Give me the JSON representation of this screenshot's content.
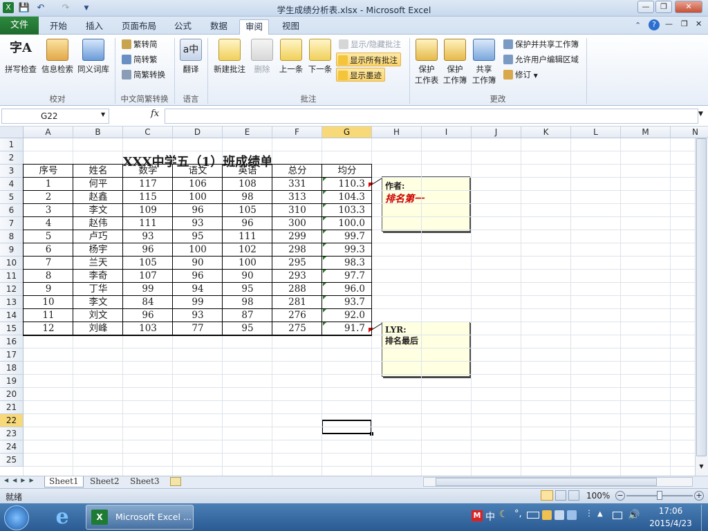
{
  "titlebar": {
    "title": "学生成绩分析表.xlsx - Microsoft Excel"
  },
  "tabs": {
    "file": "文件",
    "items": [
      "开始",
      "插入",
      "页面布局",
      "公式",
      "数据",
      "审阅",
      "视图"
    ],
    "active": "审阅"
  },
  "ribbon": {
    "proofing": {
      "spell": "拼写检查",
      "research": "信息检索",
      "thesaurus": "同义词库",
      "label": "校对"
    },
    "chinese": {
      "t2s": "繁转简",
      "s2t": "简转繁",
      "convert": "简繁转换",
      "label": "中文简繁转换"
    },
    "language": {
      "translate": "翻译",
      "label": "语言"
    },
    "comments": {
      "new": "新建批注",
      "delete": "删除",
      "prev": "上一条",
      "next": "下一条",
      "showhide": "显示/隐藏批注",
      "showall": "显示所有批注",
      "showink": "显示墨迹",
      "label": "批注"
    },
    "changes": {
      "protect_sheet_1": "保护",
      "protect_sheet_2": "工作表",
      "protect_wb_1": "保护",
      "protect_wb_2": "工作簿",
      "share_1": "共享",
      "share_2": "工作簿",
      "protect_share": "保护并共享工作簿",
      "allow_edit": "允许用户编辑区域",
      "track": "修订",
      "label": "更改"
    }
  },
  "formula_bar": {
    "name_box": "G22",
    "fx": "fx",
    "content": ""
  },
  "columns": [
    "A",
    "B",
    "C",
    "D",
    "E",
    "F",
    "G",
    "H",
    "I",
    "J",
    "K",
    "L",
    "M",
    "N"
  ],
  "rows": [
    "1",
    "2",
    "3",
    "4",
    "5",
    "6",
    "7",
    "8",
    "9",
    "10",
    "11",
    "12",
    "13",
    "14",
    "15",
    "16",
    "17",
    "18",
    "19",
    "20",
    "21",
    "22",
    "23",
    "24",
    "25"
  ],
  "sheet": {
    "title": "XXX中学五（1）班成绩单",
    "headers": [
      "序号",
      "姓名",
      "数学",
      "语文",
      "英语",
      "总分",
      "均分"
    ],
    "data": [
      [
        "1",
        "何平",
        "117",
        "106",
        "108",
        "331",
        "110.3"
      ],
      [
        "2",
        "赵鑫",
        "115",
        "100",
        "98",
        "313",
        "104.3"
      ],
      [
        "3",
        "李文",
        "109",
        "96",
        "105",
        "310",
        "103.3"
      ],
      [
        "4",
        "赵伟",
        "111",
        "93",
        "96",
        "300",
        "100.0"
      ],
      [
        "5",
        "卢巧",
        "93",
        "95",
        "111",
        "299",
        "99.7"
      ],
      [
        "6",
        "杨宇",
        "96",
        "100",
        "102",
        "298",
        "99.3"
      ],
      [
        "7",
        "兰天",
        "105",
        "90",
        "100",
        "295",
        "98.3"
      ],
      [
        "8",
        "李奇",
        "107",
        "96",
        "90",
        "293",
        "97.7"
      ],
      [
        "9",
        "丁华",
        "99",
        "94",
        "95",
        "288",
        "96.0"
      ],
      [
        "10",
        "李文",
        "84",
        "99",
        "98",
        "281",
        "93.7"
      ],
      [
        "11",
        "刘文",
        "96",
        "93",
        "87",
        "276",
        "92.0"
      ],
      [
        "12",
        "刘峰",
        "103",
        "77",
        "95",
        "275",
        "91.7"
      ]
    ]
  },
  "comments": [
    {
      "author": "作者:",
      "text": "排名第一"
    },
    {
      "author": "LYR:",
      "text": "排名最后"
    }
  ],
  "sheet_tabs": [
    "Sheet1",
    "Sheet2",
    "Sheet3"
  ],
  "status": {
    "ready": "就绪",
    "zoom": "100%"
  },
  "taskbar": {
    "app": "Microsoft Excel ...",
    "ime": "中",
    "time": "17:06",
    "date": "2015/4/23"
  }
}
